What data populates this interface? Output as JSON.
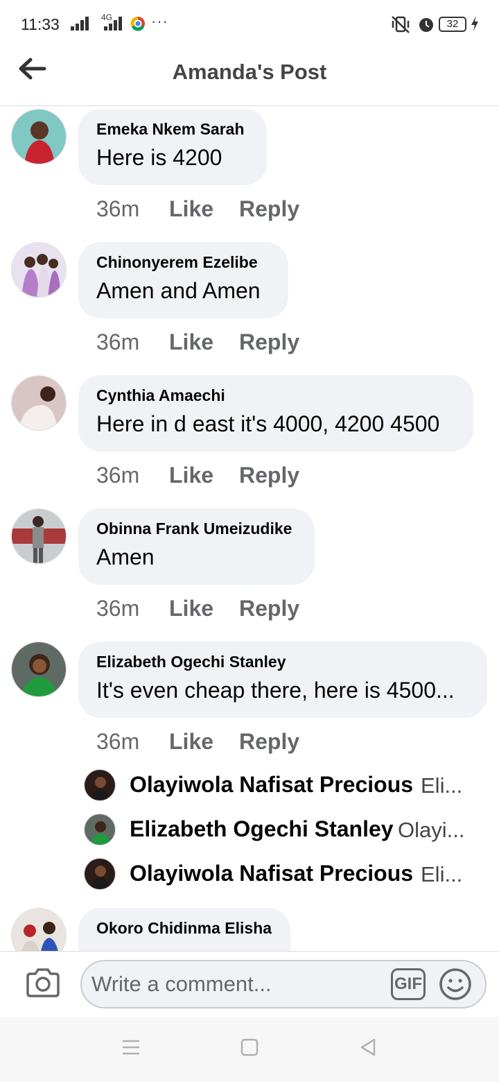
{
  "status_bar": {
    "time": "11:33",
    "network": "4G",
    "battery": "32"
  },
  "header": {
    "title": "Amanda's Post"
  },
  "comments": [
    {
      "author": "Emeka Nkem Sarah",
      "text": "Here is 4200",
      "time": "36m",
      "like": "Like",
      "reply": "Reply"
    },
    {
      "author": "Chinonyerem Ezelibe",
      "text": "Amen and Amen",
      "time": "36m",
      "like": "Like",
      "reply": "Reply"
    },
    {
      "author": "Cynthia Amaechi",
      "text": "Here in d east it's 4000, 4200 4500",
      "time": "36m",
      "like": "Like",
      "reply": "Reply"
    },
    {
      "author": "Obinna Frank Umeizudike",
      "text": "Amen",
      "time": "36m",
      "like": "Like",
      "reply": "Reply"
    },
    {
      "author": "Elizabeth Ogechi Stanley",
      "text": "It's even cheap there, here is 4500...",
      "time": "36m",
      "like": "Like",
      "reply": "Reply"
    },
    {
      "author": "Okoro Chidinma Elisha",
      "text": ""
    }
  ],
  "replies": [
    {
      "author": "Olayiwola Nafisat Precious",
      "snippet": "Eli..."
    },
    {
      "author": "Elizabeth Ogechi Stanley",
      "snippet": "Olayi..."
    },
    {
      "author": "Olayiwola Nafisat Precious",
      "snippet": "Eli..."
    }
  ],
  "composer": {
    "placeholder": "Write a comment...",
    "gif_label": "GIF"
  },
  "colors": {
    "bubble": "#f0f2f5",
    "secondary_text": "#65676b",
    "header_title": "#444444"
  }
}
